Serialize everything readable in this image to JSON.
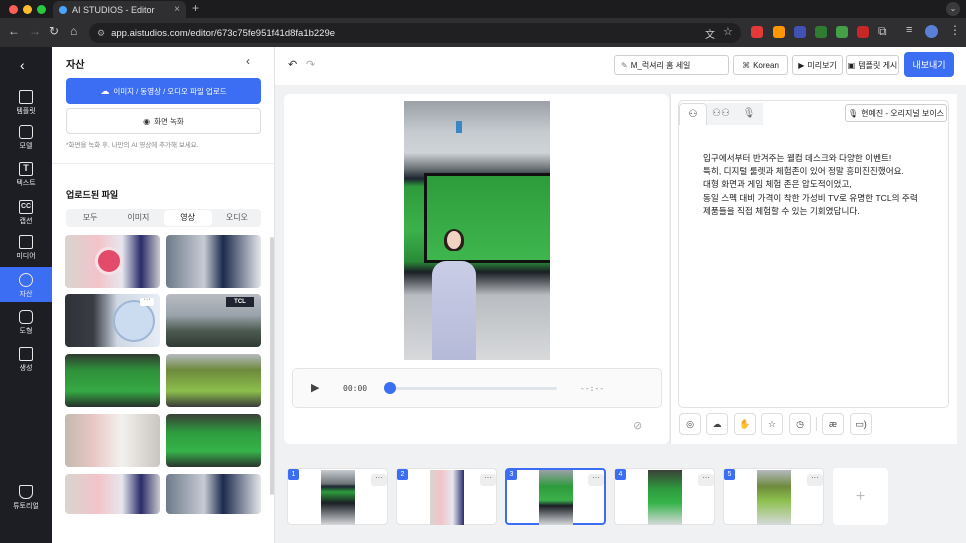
{
  "browser": {
    "tab_title": "AI STUDIOS - Editor",
    "url": "app.aistudios.com/editor/673c75fe951f41d8fa1b229e"
  },
  "leftnav": {
    "items": [
      {
        "label": "템플릿",
        "icon": "template-icon"
      },
      {
        "label": "모델",
        "icon": "model-icon"
      },
      {
        "label": "텍스트",
        "icon": "text-icon"
      },
      {
        "label": "캡션",
        "icon": "caption-icon"
      },
      {
        "label": "미디어",
        "icon": "media-icon"
      },
      {
        "label": "자산",
        "icon": "asset-icon"
      },
      {
        "label": "도형",
        "icon": "shape-icon"
      },
      {
        "label": "생성",
        "icon": "generate-icon"
      }
    ],
    "bottom_label": "튜토리얼"
  },
  "panel": {
    "title": "자산",
    "upload_label": "이미지 / 동영상 / 오디오 파일 업로드",
    "record_label": "화면 녹화",
    "hint": "*화면을 녹화 후, 나만의 AI 영상에 추가해 보세요.",
    "uploaded_title": "업로드된 파일",
    "filters": [
      "모두",
      "이미지",
      "영상",
      "오디오"
    ],
    "active_filter": "영상"
  },
  "toolbar": {
    "project_name": "M_럭셔리 홈 세일",
    "language": "Korean",
    "preview": "미리보기",
    "template_post": "템플릿 게시",
    "export": "내보내기"
  },
  "player": {
    "current_time": "00:00",
    "total_time": "--:--"
  },
  "script": {
    "voice": "현예진 - 오리지널 보이스",
    "lines": [
      "입구에서부터 반겨주는 웰컴 데스크와 다양한 이벤트!",
      "특히, 디지털 룰렛과 체험존이 있어 정말 흥미진진했어요.",
      "대형 화면과 게임 체험 존은 압도적이었고,",
      "동일 스펙 대비 가격이 착한 가성비 TV로 유명한 TCL의 주력",
      "제품들을 직접 체험할 수 있는 기회였답니다."
    ]
  },
  "timeline": {
    "scenes": [
      "1",
      "2",
      "3",
      "4",
      "5"
    ],
    "selected": "3"
  },
  "colors": {
    "accent": "#3b6ef3",
    "nav_bg": "#1c1e24"
  }
}
